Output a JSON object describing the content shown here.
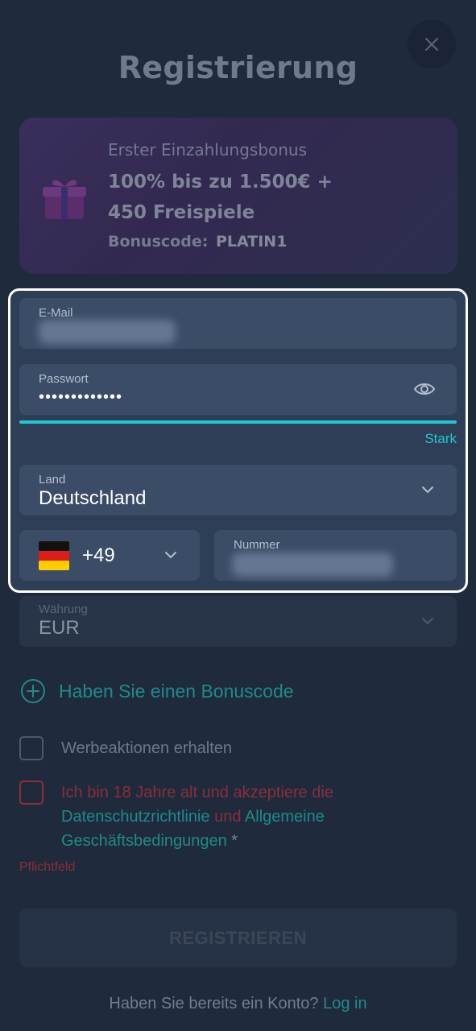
{
  "header": {
    "title": "Registrierung",
    "close_icon": "close-icon"
  },
  "bonus": {
    "title": "Erster Einzahlungsbonus",
    "offer": "100% bis zu 1.500€ + 450 Freispiele",
    "code_label": "Bonuscode:",
    "code_value": "PLATIN1",
    "icon": "gift-icon"
  },
  "form": {
    "email": {
      "label": "E-Mail",
      "value": ""
    },
    "password": {
      "label": "Passwort",
      "value": "•••••••••••••",
      "strength": "Stark",
      "strength_color": "#21c7d1",
      "toggle_icon": "eye-icon"
    },
    "country": {
      "label": "Land",
      "value": "Deutschland",
      "icon": "chevron-down-icon"
    },
    "phone": {
      "prefix": "+49",
      "flag": "germany-flag-icon",
      "number_label": "Nummer",
      "number_value": ""
    },
    "currency": {
      "label": "Währung",
      "value": "EUR"
    }
  },
  "bonus_code_toggle": {
    "label": "Haben Sie einen Bonuscode",
    "icon": "plus-circle-icon"
  },
  "checkboxes": {
    "promotions": {
      "label": "Werbeaktionen erhalten",
      "checked": false
    },
    "terms": {
      "part1": "Ich bin 18 Jahre alt und akzeptiere die",
      "link1": "Datenschutzrichtlinie",
      "part2": "und",
      "link2": "Allgemeine Geschäftsbedingungen",
      "star": "*",
      "checked": false
    }
  },
  "required_note": "Pflichtfeld",
  "register_button": "REGISTRIEREN",
  "login": {
    "text": "Haben Sie bereits ein Konto?",
    "link": "Log in"
  },
  "colors": {
    "accent": "#21c7d1",
    "link": "#1f8b88",
    "error": "#8b2e36",
    "background": "#1f2a3d"
  }
}
